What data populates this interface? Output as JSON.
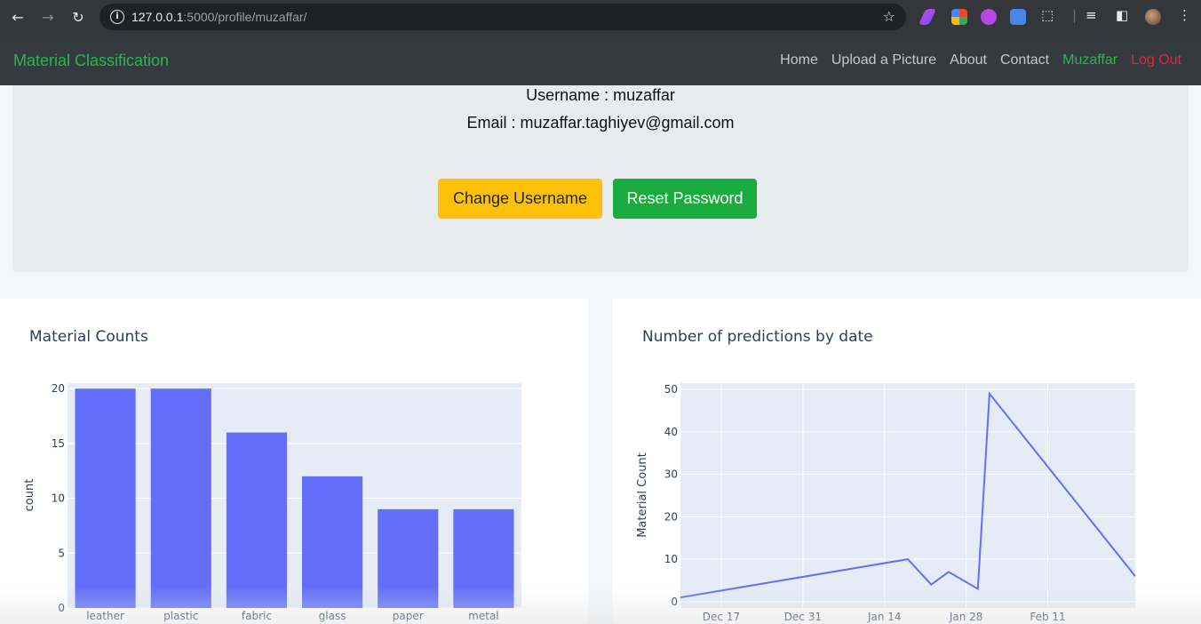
{
  "browser": {
    "url_host": "127.0.0.1",
    "url_rest": ":5000/profile/muzaffar/",
    "icons": [
      "back-icon",
      "forward-icon",
      "reload-icon",
      "info-icon",
      "star-icon",
      "extension-icon",
      "tab-search-icon",
      "sidebar-icon",
      "profile-avatar",
      "more-menu-icon"
    ]
  },
  "navbar": {
    "brand": "Material Classification",
    "links": [
      "Home",
      "Upload a Picture",
      "About",
      "Contact"
    ],
    "user": "Muzaffar",
    "logout": "Log Out"
  },
  "profile": {
    "username_line": "Username : muzaffar",
    "email_line": "Email : muzaffar.taghiyev@gmail.com",
    "change_username_label": "Change Username",
    "reset_password_label": "Reset Password"
  },
  "colors": {
    "bar": "#636efa",
    "line": "#636efa",
    "plot_bg": "#e5ecf6",
    "brand": "#28b84a",
    "logout": "#e0263b",
    "warning": "#ffc107",
    "success": "#1aab3e"
  },
  "chart_data": [
    {
      "type": "bar",
      "title": "Material Counts",
      "ylabel": "count",
      "xlabel": "",
      "categories": [
        "leather",
        "plastic",
        "fabric",
        "glass",
        "paper",
        "metal"
      ],
      "values": [
        20,
        20,
        16,
        12,
        9,
        9
      ],
      "ylim": [
        0,
        20.5
      ],
      "yticks": [
        0,
        5,
        10,
        15,
        20
      ],
      "grid": true
    },
    {
      "type": "line",
      "title": "Number of predictions by date",
      "ylabel": "Material Count",
      "xlabel": "",
      "x": [
        "2023-12-10",
        "2024-01-18",
        "2024-01-22",
        "2024-01-25",
        "2024-01-30",
        "2024-02-01",
        "2024-02-26"
      ],
      "y": [
        1,
        10,
        4,
        7,
        3,
        49,
        6
      ],
      "xlim": [
        "2023-12-10",
        "2024-02-26"
      ],
      "ylim": [
        -1.5,
        51.5
      ],
      "xticks": [
        "2023-12-17",
        "2023-12-31",
        "2024-01-14",
        "2024-01-28",
        "2024-02-11"
      ],
      "xtick_labels": [
        "Dec 17",
        "Dec 31",
        "Jan 14",
        "Jan 28",
        "Feb 11"
      ],
      "yticks": [
        0,
        10,
        20,
        30,
        40,
        50
      ],
      "grid": true
    }
  ]
}
